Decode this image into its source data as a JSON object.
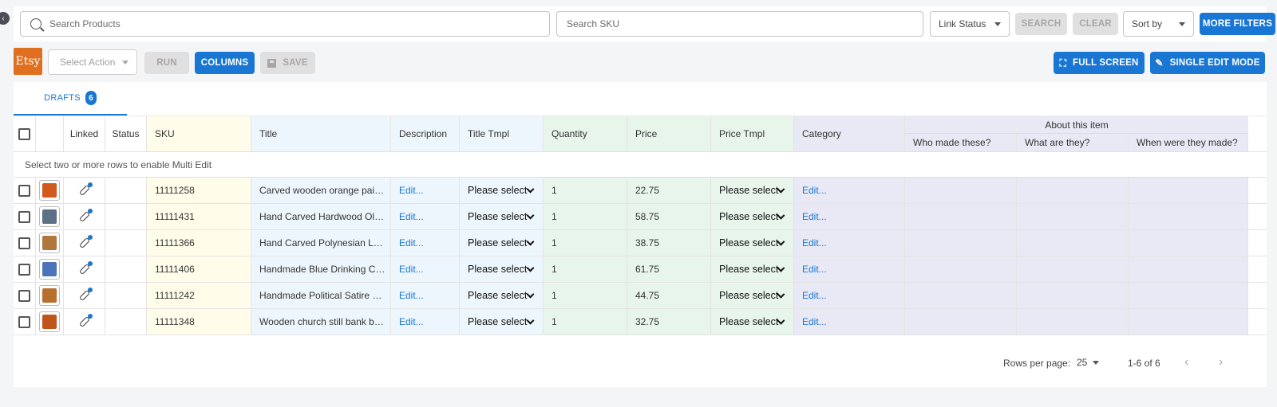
{
  "top": {
    "search_products_placeholder": "Search Products",
    "search_sku_placeholder": "Search SKU",
    "link_status": "Link Status",
    "search_label": "SEARCH",
    "clear_label": "CLEAR",
    "sort_by": "Sort by",
    "more_filters_label": "MORE FILTERS"
  },
  "toolbar": {
    "logo_text": "Etsy",
    "select_action": "Select Action",
    "run_label": "RUN",
    "columns_label": "COLUMNS",
    "save_label": "SAVE",
    "fullscreen_label": "FULL SCREEN",
    "single_edit_label": "SINGLE EDIT MODE"
  },
  "tabs": [
    {
      "label": "DRAFTS",
      "count": "6"
    }
  ],
  "table": {
    "headers": {
      "linked": "Linked",
      "status": "Status",
      "sku": "SKU",
      "title": "Title",
      "description": "Description",
      "title_tmpl": "Title Tmpl",
      "quantity": "Quantity",
      "price": "Price",
      "price_tmpl": "Price Tmpl",
      "category": "Category",
      "about_group": "About this item",
      "who": "Who made these?",
      "what": "What are they?",
      "when": "When were they made?"
    },
    "notice": "Select two or more rows to enable Multi Edit",
    "rows": [
      {
        "sku": "11111258",
        "title": "Carved wooden orange painte…",
        "description": "Edit...",
        "title_tmpl": "Please select",
        "quantity": "1",
        "price": "22.75",
        "price_tmpl": "Please select",
        "category": "Edit...",
        "thumb_color": "#d25a1c"
      },
      {
        "sku": "11111431",
        "title": "Hand Carved Hardwood Old M…",
        "description": "Edit...",
        "title_tmpl": "Please select",
        "quantity": "1",
        "price": "58.75",
        "price_tmpl": "Please select",
        "category": "Edit...",
        "thumb_color": "#5b6f86"
      },
      {
        "sku": "11111366",
        "title": "Hand Carved Polynesian Lady …",
        "description": "Edit...",
        "title_tmpl": "Please select",
        "quantity": "1",
        "price": "38.75",
        "price_tmpl": "Please select",
        "category": "Edit...",
        "thumb_color": "#b0763c"
      },
      {
        "sku": "11111406",
        "title": "Handmade Blue Drinking Cock…",
        "description": "Edit...",
        "title_tmpl": "Please select",
        "quantity": "1",
        "price": "61.75",
        "price_tmpl": "Please select",
        "category": "Edit...",
        "thumb_color": "#4c74b8"
      },
      {
        "sku": "11111242",
        "title": "Handmade Political Satire Woo…",
        "description": "Edit...",
        "title_tmpl": "Please select",
        "quantity": "1",
        "price": "44.75",
        "price_tmpl": "Please select",
        "category": "Edit...",
        "thumb_color": "#b86e2c"
      },
      {
        "sku": "11111348",
        "title": "Wooden church still bank by B…",
        "description": "Edit...",
        "title_tmpl": "Please select",
        "quantity": "1",
        "price": "32.75",
        "price_tmpl": "Please select",
        "category": "Edit...",
        "thumb_color": "#c0541a"
      }
    ]
  },
  "footer": {
    "rows_per_page_label": "Rows per page:",
    "rows_per_page": "25",
    "range": "1-6 of 6"
  }
}
